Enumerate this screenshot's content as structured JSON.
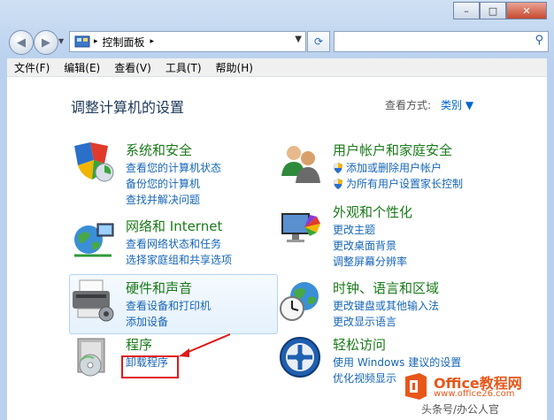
{
  "window": {
    "buttons": {
      "minimize": "–",
      "maximize": "□",
      "close": "✕"
    }
  },
  "nav": {
    "back_icon": "arrow-left-icon",
    "forward_icon": "arrow-right-icon",
    "breadcrumb": "控制面板",
    "breadcrumb_sep": "▸",
    "search_placeholder": ""
  },
  "menu": [
    "文件(F)",
    "编辑(E)",
    "查看(V)",
    "工具(T)",
    "帮助(H)"
  ],
  "page": {
    "title": "调整计算机的设置",
    "view_by_label": "查看方式:",
    "view_by_value": "类别 ▼"
  },
  "categories": [
    {
      "title": "系统和安全",
      "links": [
        "查看您的计算机状态",
        "备份您的计算机",
        "查找并解决问题"
      ]
    },
    {
      "title": "用户帐户和家庭安全",
      "links": [
        "添加或删除用户帐户",
        "为所有用户设置家长控制"
      ]
    },
    {
      "title": "网络和 Internet",
      "links": [
        "查看网络状态和任务",
        "选择家庭组和共享选项"
      ]
    },
    {
      "title": "外观和个性化",
      "links": [
        "更改主题",
        "更改桌面背景",
        "调整屏幕分辨率"
      ]
    },
    {
      "title": "硬件和声音",
      "links": [
        "查看设备和打印机",
        "添加设备"
      ]
    },
    {
      "title": "时钟、语言和区域",
      "links": [
        "更改键盘或其他输入法",
        "更改显示语言"
      ]
    },
    {
      "title": "程序",
      "links": [
        "卸载程序"
      ]
    },
    {
      "title": "轻松访问",
      "links": [
        "使用 Windows 建议的设置",
        "优化视频显示"
      ]
    }
  ],
  "watermark": {
    "brand": "Office教程网",
    "url": "www.office26.com",
    "caption": "头条号/办公人官"
  },
  "colors": {
    "category_green": "#1a7a1a",
    "link_blue": "#1666b8",
    "highlight_red": "#e01919",
    "title_navy": "#1e395b"
  }
}
